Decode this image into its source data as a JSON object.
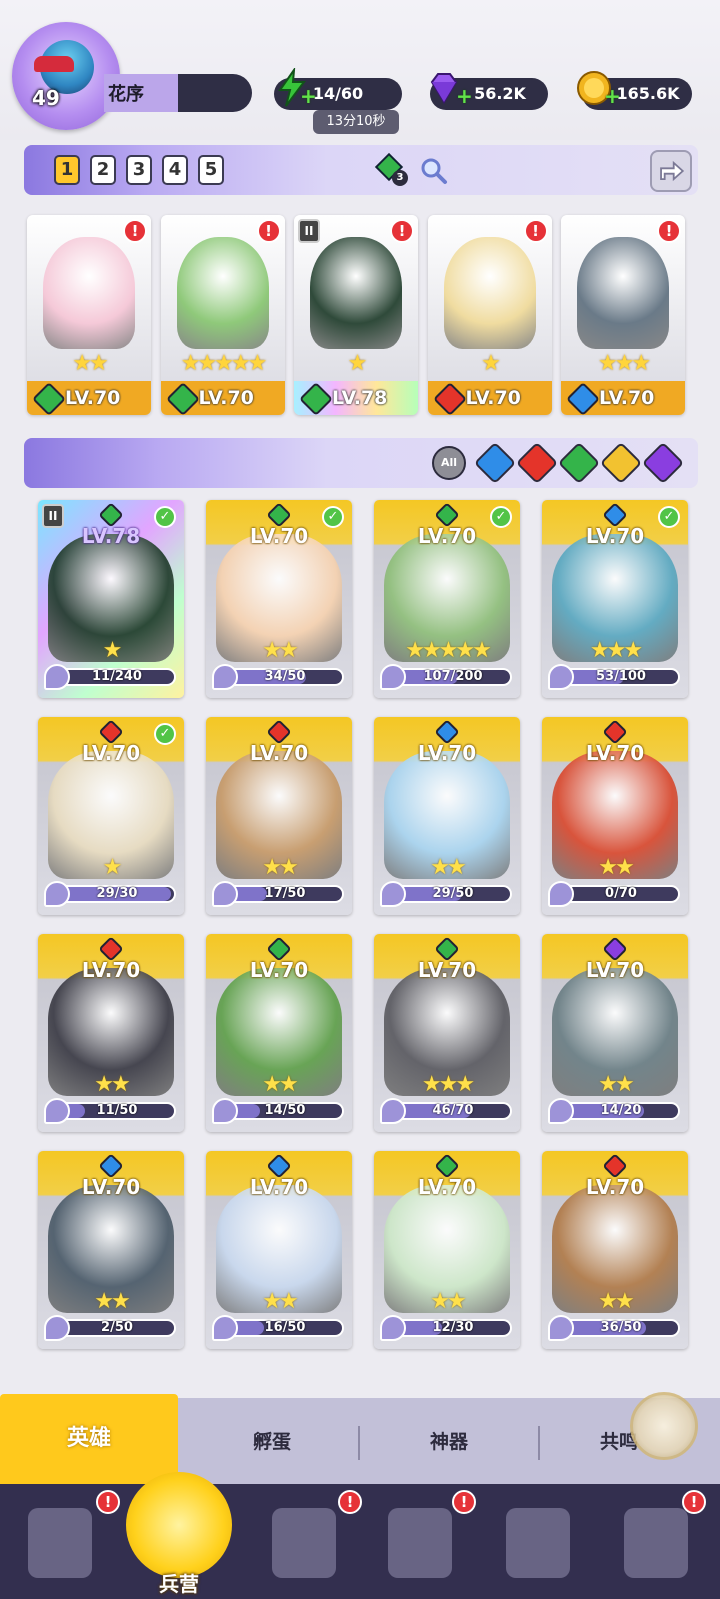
{
  "player": {
    "level": "49",
    "name": "花序",
    "avatar_icon": "player-avatar"
  },
  "resources": {
    "energy": {
      "value": "14/60",
      "timer": "13分10秒",
      "icon": "lightning-icon",
      "color": "#38c43a"
    },
    "gems": {
      "value": "56.2K",
      "icon": "diamond-icon",
      "color": "#9b5cf0"
    },
    "gold": {
      "value": "165.6K",
      "icon": "coin-icon",
      "color": "#f1b51f"
    }
  },
  "team_tabs": [
    "1",
    "2",
    "3",
    "4",
    "5"
  ],
  "team_active_tab": "1",
  "team_badge": "3",
  "team": [
    {
      "level": "LV.70",
      "stars": "★★",
      "element": "nature",
      "alert": "!"
    },
    {
      "level": "LV.70",
      "stars": "★★★★★",
      "element": "nature",
      "alert": "!"
    },
    {
      "level": "LV.78",
      "stars": "★",
      "element": "nature",
      "alert": "!",
      "rank": "II"
    },
    {
      "level": "LV.70",
      "stars": "★",
      "element": "fire",
      "alert": "!"
    },
    {
      "level": "LV.70",
      "stars": "★★★",
      "element": "water",
      "alert": "!"
    }
  ],
  "filter": {
    "all_label": "All",
    "elements": [
      "water",
      "fire",
      "nature",
      "light",
      "dark"
    ]
  },
  "element_colors": {
    "water": "#2f8de8",
    "fire": "#e4342a",
    "nature": "#34b44a",
    "light": "#f2c230",
    "dark": "#8a3ee0"
  },
  "heroes": [
    {
      "level": "LV.78",
      "stars": "★",
      "shards": "11/240",
      "fill": 0.05,
      "element": "nature",
      "checked": true,
      "rank": "II",
      "holo": true
    },
    {
      "level": "LV.70",
      "stars": "★★",
      "shards": "34/50",
      "fill": 0.68,
      "element": "nature",
      "checked": true
    },
    {
      "level": "LV.70",
      "stars": "★★★★★",
      "shards": "107/200",
      "fill": 0.54,
      "element": "nature",
      "checked": true
    },
    {
      "level": "LV.70",
      "stars": "★★★",
      "shards": "53/100",
      "fill": 0.53,
      "element": "water",
      "checked": true
    },
    {
      "level": "LV.70",
      "stars": "★",
      "shards": "29/30",
      "fill": 0.97,
      "element": "fire",
      "checked": true
    },
    {
      "level": "LV.70",
      "stars": "★★",
      "shards": "17/50",
      "fill": 0.34,
      "element": "fire"
    },
    {
      "level": "LV.70",
      "stars": "★★",
      "shards": "29/50",
      "fill": 0.58,
      "element": "water"
    },
    {
      "level": "LV.70",
      "stars": "★★",
      "shards": "0/70",
      "fill": 0.0,
      "element": "fire"
    },
    {
      "level": "LV.70",
      "stars": "★★",
      "shards": "11/50",
      "fill": 0.22,
      "element": "fire"
    },
    {
      "level": "LV.70",
      "stars": "★★",
      "shards": "14/50",
      "fill": 0.28,
      "element": "nature"
    },
    {
      "level": "LV.70",
      "stars": "★★★",
      "shards": "46/70",
      "fill": 0.66,
      "element": "nature"
    },
    {
      "level": "LV.70",
      "stars": "★★",
      "shards": "14/20",
      "fill": 0.7,
      "element": "dark"
    },
    {
      "level": "LV.70",
      "stars": "★★",
      "shards": "2/50",
      "fill": 0.04,
      "element": "water"
    },
    {
      "level": "LV.70",
      "stars": "★★",
      "shards": "16/50",
      "fill": 0.32,
      "element": "water"
    },
    {
      "level": "LV.70",
      "stars": "★★",
      "shards": "12/30",
      "fill": 0.4,
      "element": "nature"
    },
    {
      "level": "LV.70",
      "stars": "★★",
      "shards": "36/50",
      "fill": 0.72,
      "element": "fire"
    }
  ],
  "sub_tabs": [
    "英雄",
    "孵蛋",
    "神器",
    "共鸣"
  ],
  "nav": {
    "active_label": "兵营",
    "alert": "!"
  }
}
